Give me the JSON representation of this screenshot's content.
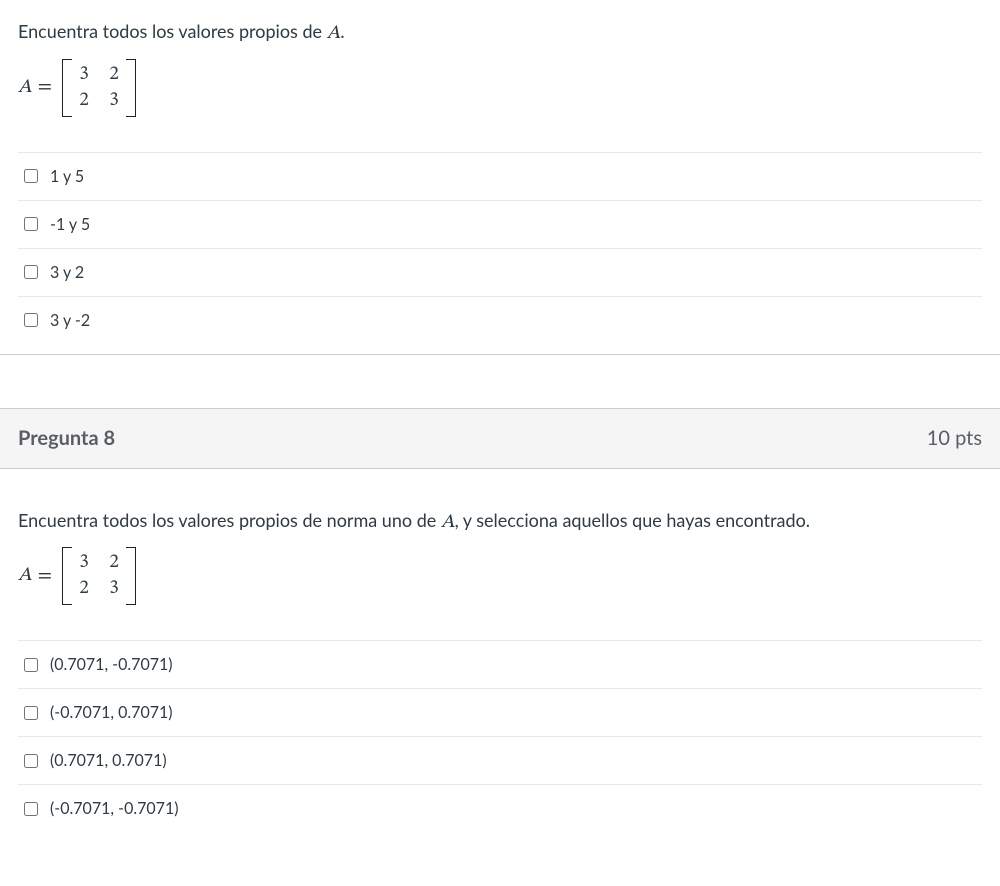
{
  "q1": {
    "prompt_prefix": "Encuentra todos los valores propios de ",
    "prompt_var": "A",
    "prompt_suffix": ".",
    "matrix_var": "A",
    "eq": "=",
    "matrix": [
      [
        "3",
        "2"
      ],
      [
        "2",
        "3"
      ]
    ],
    "options": [
      "1 y 5",
      "-1 y 5",
      "3 y 2",
      "3 y -2"
    ]
  },
  "header2": {
    "title": "Pregunta 8",
    "points": "10 pts"
  },
  "q2": {
    "prompt_prefix": "Encuentra todos los valores propios de norma uno de ",
    "prompt_var": "A",
    "prompt_mid": ", y selecciona aquellos que hayas encontrado.",
    "matrix_var": "A",
    "eq": "=",
    "matrix": [
      [
        "3",
        "2"
      ],
      [
        "2",
        "3"
      ]
    ],
    "options": [
      "(0.7071, -0.7071)",
      "(-0.7071, 0.7071)",
      "(0.7071, 0.7071)",
      "(-0.7071, -0.7071)"
    ]
  }
}
